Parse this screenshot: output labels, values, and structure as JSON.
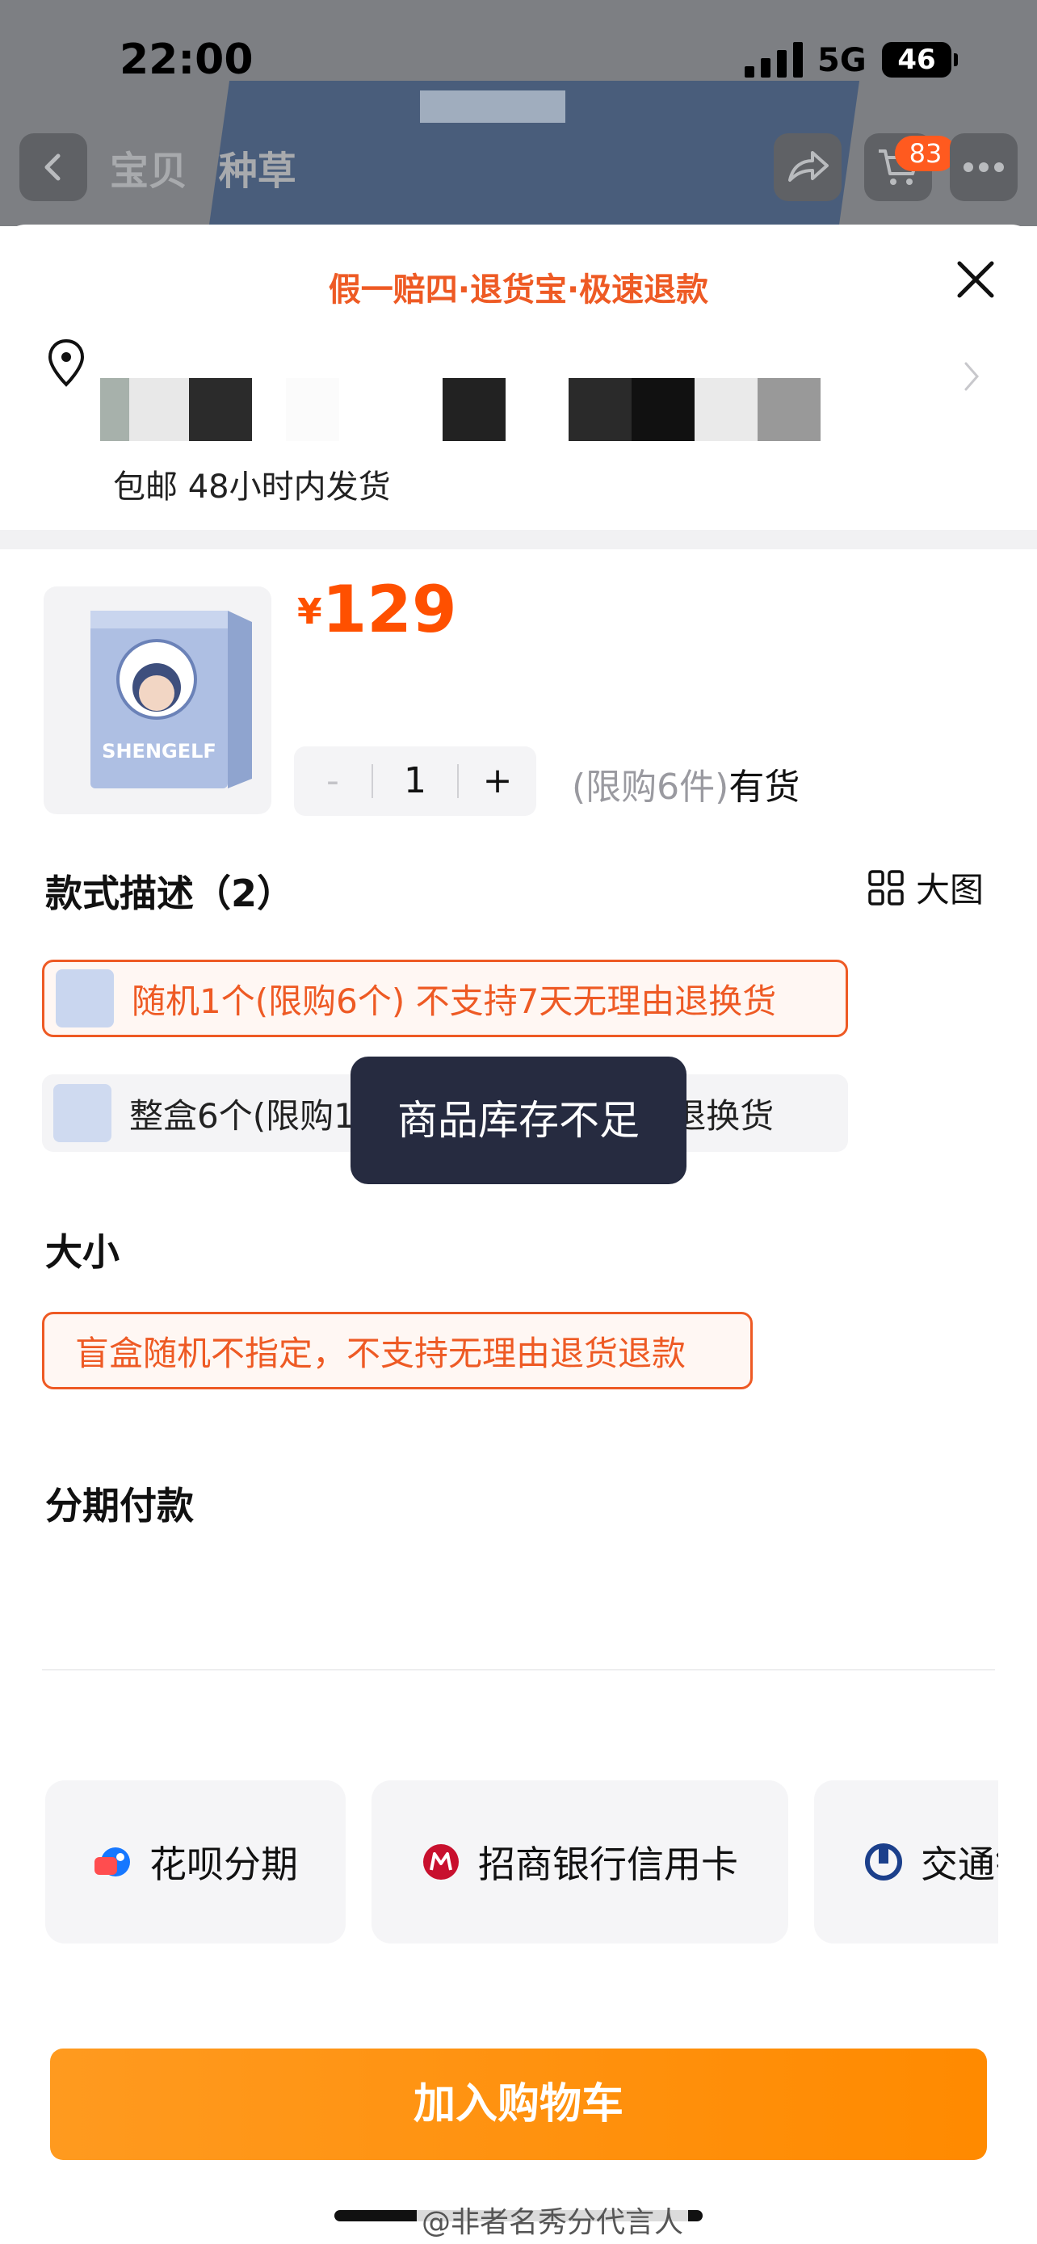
{
  "status_bar": {
    "time": "22:00",
    "network": "5G",
    "battery": "46"
  },
  "nav": {
    "tab_baobei": "宝贝",
    "tab_zhongcao": "种草",
    "cart_badge": "83"
  },
  "sheet": {
    "guarantee": "假一赔四·退货宝·极速退款",
    "shipping": "包邮 48小时内发货"
  },
  "product": {
    "currency": "¥",
    "price": "129",
    "quantity": "1",
    "minus": "-",
    "plus": "+",
    "limit": "(限购6件)",
    "stock": "有货",
    "thumb_text": "SHENGELF"
  },
  "style_section": {
    "title": "款式描述（2）",
    "big_view": "大图",
    "options": [
      {
        "label": "随机1个(限购6个) 不支持7天无理由退换货",
        "selected": true
      },
      {
        "label": "整盒6个(限购1盒) 不支持7天无理由退换货",
        "selected": false
      }
    ]
  },
  "toast": "商品库存不足",
  "size_section": {
    "title": "大小",
    "option": "盲盒随机不指定，不支持无理由退货退款"
  },
  "installment": {
    "title": "分期付款",
    "options": [
      "花呗分期",
      "招商银行信用卡",
      "交通银行信用卡"
    ]
  },
  "add_cart": "加入购物车",
  "watermark": "@非者名秀分代言人",
  "colors": {
    "accent": "#ee5a24",
    "price": "#ff5000",
    "button": "#ff8a00",
    "toast_bg": "#262b40"
  }
}
